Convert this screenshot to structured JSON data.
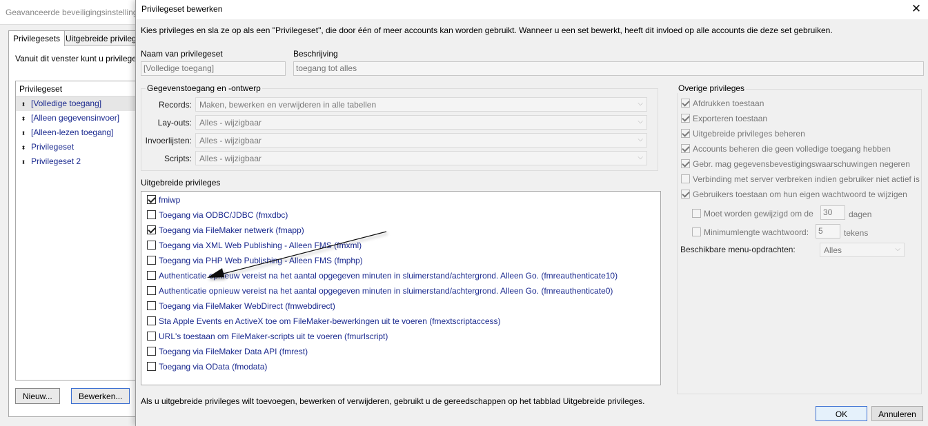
{
  "background_window": {
    "title": "Geavanceerde beveiligingsinstellingen",
    "tabs": [
      "Privilegesets",
      "Uitgebreide privileges"
    ],
    "intro": "Vanuit dit venster kunt u privileges",
    "list_header": "Privilegeset",
    "items": [
      "[Volledige toegang]",
      "[Alleen gegevensinvoer]",
      "[Alleen-lezen toegang]",
      "Privilegeset",
      "Privilegeset 2"
    ],
    "buttons": {
      "new": "Nieuw...",
      "edit": "Bewerken..."
    }
  },
  "dialog": {
    "title": "Privilegeset bewerken",
    "close_glyph": "✕",
    "intro": "Kies privileges en sla ze op als een \"Privilegeset\", die door één of meer accounts kan worden gebruikt. Wanneer u een set bewerkt, heeft dit invloed op alle accounts die deze set gebruiken.",
    "name_label": "Naam van privilegeset",
    "name_value": "[Volledige toegang]",
    "desc_label": "Beschrijving",
    "desc_value": "toegang tot alles",
    "data_access": {
      "title": "Gegevenstoegang en -ontwerp",
      "rows": [
        {
          "label": "Records:",
          "value": "Maken, bewerken en verwijderen in alle tabellen"
        },
        {
          "label": "Lay-outs:",
          "value": "Alles - wijzigbaar"
        },
        {
          "label": "Invoerlijsten:",
          "value": "Alles - wijzigbaar"
        },
        {
          "label": "Scripts:",
          "value": "Alles - wijzigbaar"
        }
      ]
    },
    "extended": {
      "title": "Uitgebreide privileges",
      "items": [
        {
          "label": "fmiwp",
          "checked": true
        },
        {
          "label": "Toegang via ODBC/JDBC (fmxdbc)",
          "checked": false
        },
        {
          "label": "Toegang via FileMaker netwerk (fmapp)",
          "checked": true
        },
        {
          "label": "Toegang via XML Web Publishing - Alleen FMS (fmxml)",
          "checked": false
        },
        {
          "label": "Toegang via PHP Web Publishing - Alleen FMS (fmphp)",
          "checked": false
        },
        {
          "label": "Authenticatie opnieuw vereist na het aantal opgegeven minuten in sluimerstand/achtergrond. Alleen Go. (fmreauthenticate10)",
          "checked": false
        },
        {
          "label": "Authenticatie opnieuw vereist na het aantal opgegeven minuten in sluimerstand/achtergrond. Alleen Go. (fmreauthenticate0)",
          "checked": false
        },
        {
          "label": "Toegang via FileMaker WebDirect (fmwebdirect)",
          "checked": false
        },
        {
          "label": "Sta Apple Events en ActiveX toe om FileMaker-bewerkingen uit te voeren (fmextscriptaccess)",
          "checked": false
        },
        {
          "label": "URL's toestaan om FileMaker-scripts uit te voeren (fmurlscript)",
          "checked": false
        },
        {
          "label": "Toegang via FileMaker Data API (fmrest)",
          "checked": false
        },
        {
          "label": "Toegang via OData (fmodata)",
          "checked": false
        }
      ]
    },
    "footnote": "Als u uitgebreide privileges wilt toevoegen, bewerken of verwijderen, gebruikt u de gereedschappen op het tabblad Uitgebreide privileges.",
    "other": {
      "title": "Overige privileges",
      "items": [
        {
          "label": "Afdrukken toestaan",
          "checked": true
        },
        {
          "label": "Exporteren toestaan",
          "checked": true
        },
        {
          "label": "Uitgebreide privileges beheren",
          "checked": true
        },
        {
          "label": "Accounts beheren die geen volledige toegang hebben",
          "checked": true
        },
        {
          "label": "Gebr. mag gegevensbevestigingswaarschuwingen negeren",
          "checked": true
        },
        {
          "label": "Verbinding met server verbreken indien gebruiker niet actief is",
          "checked": false
        },
        {
          "label": "Gebruikers toestaan om hun eigen wachtwoord te wijzigen",
          "checked": true
        }
      ],
      "change_every": {
        "label": "Moet worden gewijzigd om de",
        "value": "30",
        "unit": "dagen",
        "checked": false
      },
      "min_length": {
        "label": "Minimumlengte wachtwoord:",
        "value": "5",
        "unit": "tekens",
        "checked": false
      },
      "menu_label": "Beschikbare menu-opdrachten:",
      "menu_value": "Alles"
    },
    "ok": "OK",
    "cancel": "Annuleren"
  }
}
